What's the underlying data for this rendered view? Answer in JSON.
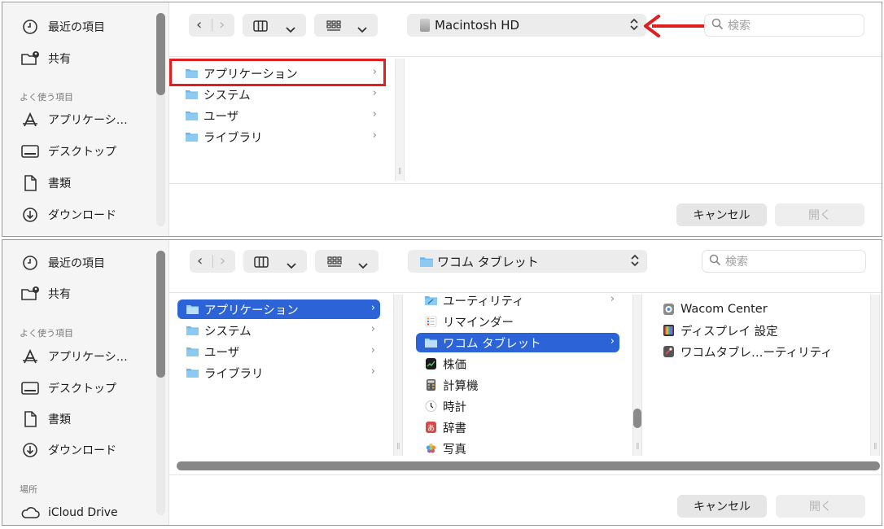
{
  "top": {
    "sidebar": {
      "items": [
        {
          "label": "最近の項目",
          "icon": "clock-icon"
        },
        {
          "label": "共有",
          "icon": "shared-folder-icon"
        }
      ],
      "section_favorites": "よく使う項目",
      "favorites": [
        {
          "label": "アプリケーシ…",
          "icon": "applications-icon"
        },
        {
          "label": "デスクトップ",
          "icon": "desktop-icon"
        },
        {
          "label": "書類",
          "icon": "document-icon"
        },
        {
          "label": "ダウンロード",
          "icon": "download-icon"
        }
      ]
    },
    "toolbar": {
      "back": "‹",
      "forward": "›",
      "path_label": "Macintosh HD",
      "search_placeholder": "検索"
    },
    "column1": [
      {
        "label": "アプリケーション",
        "highlighted": true
      },
      {
        "label": "システム"
      },
      {
        "label": "ユーザ"
      },
      {
        "label": "ライブラリ"
      }
    ],
    "footer": {
      "cancel": "キャンセル",
      "open": "開く"
    }
  },
  "bottom": {
    "sidebar": {
      "items": [
        {
          "label": "最近の項目",
          "icon": "clock-icon"
        },
        {
          "label": "共有",
          "icon": "shared-folder-icon"
        }
      ],
      "section_favorites": "よく使う項目",
      "favorites": [
        {
          "label": "アプリケーシ…",
          "icon": "applications-icon"
        },
        {
          "label": "デスクトップ",
          "icon": "desktop-icon"
        },
        {
          "label": "書類",
          "icon": "document-icon"
        },
        {
          "label": "ダウンロード",
          "icon": "download-icon"
        }
      ],
      "section_locations": "場所",
      "locations": [
        {
          "label": "iCloud Drive",
          "icon": "cloud-icon"
        }
      ]
    },
    "toolbar": {
      "path_label": "ワコム タブレット",
      "search_placeholder": "検索"
    },
    "column1": [
      {
        "label": "アプリケーション",
        "selected": true
      },
      {
        "label": "システム"
      },
      {
        "label": "ユーザ"
      },
      {
        "label": "ライブラリ"
      }
    ],
    "column2": [
      {
        "label": "ユーティリティ",
        "icon": "utilities-folder-icon",
        "chevron": true
      },
      {
        "label": "リマインダー",
        "icon": "reminders-app-icon"
      },
      {
        "label": "ワコム タブレット",
        "icon": "folder-icon",
        "chevron": true,
        "selected": true
      },
      {
        "label": "株価",
        "icon": "stocks-app-icon"
      },
      {
        "label": "計算機",
        "icon": "calculator-app-icon"
      },
      {
        "label": "時計",
        "icon": "clock-app-icon"
      },
      {
        "label": "辞書",
        "icon": "dictionary-app-icon"
      },
      {
        "label": "写真",
        "icon": "photos-app-icon"
      }
    ],
    "column3": [
      {
        "label": "Wacom Center",
        "icon": "wacom-center-icon"
      },
      {
        "label": "ディスプレイ 設定",
        "icon": "display-settings-icon"
      },
      {
        "label": "ワコムタブレ…ーティリティ",
        "icon": "wacom-utility-icon"
      }
    ],
    "footer": {
      "cancel": "キャンセル",
      "open": "開く"
    }
  },
  "colors": {
    "selection": "#2c64d8",
    "highlight_box": "#e02020",
    "arrow": "#e02020",
    "folder": "#6fb6e8"
  }
}
